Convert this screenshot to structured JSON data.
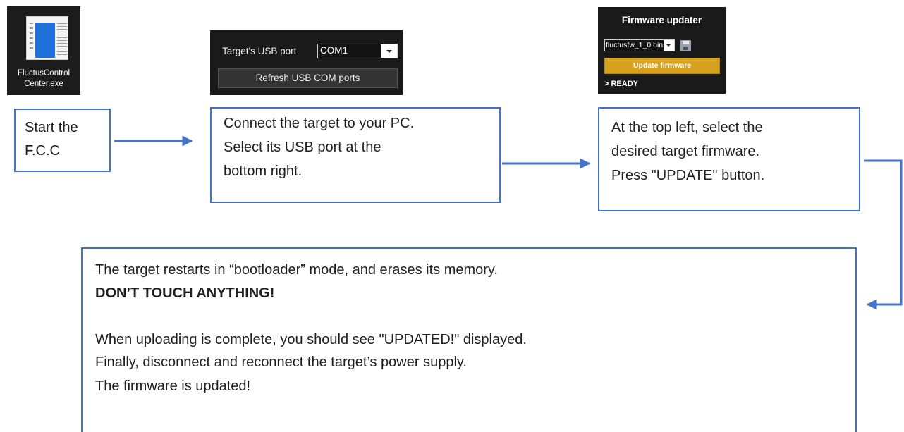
{
  "desktop_icon": {
    "label_line1": "FluctusControl",
    "label_line2": "Center.exe"
  },
  "usb_panel": {
    "port_label": "Target's USB port",
    "port_value": "COM1",
    "refresh_button": "Refresh USB COM ports"
  },
  "firmware_panel": {
    "title": "Firmware updater",
    "file_value": "fluctusfw_1_0.bin",
    "update_button": "Update firmware",
    "status": "> READY"
  },
  "steps": {
    "step1": {
      "line1": "Start the",
      "line2": "F.C.C"
    },
    "step2": {
      "line1": "Connect the target to your PC.",
      "line2": "Select its USB port at the",
      "line3": "bottom right."
    },
    "step3": {
      "line1": "At the top left, select the",
      "line2": "desired target firmware.",
      "line3": "Press \"UPDATE\" button."
    },
    "step4": {
      "line1": "The target restarts in “bootloader” mode, and erases its memory.",
      "warning": "DON’T TOUCH ANYTHING!",
      "line3": "When uploading is complete, you should see \"UPDATED!\" displayed.",
      "line4": "Finally, disconnect and reconnect the target’s power supply.",
      "final": "The firmware is updated!"
    }
  },
  "colors": {
    "box_border": "#4472c4",
    "arrow": "#4472c4",
    "final_text": "#1f6fe0",
    "update_button": "#d6a11f"
  }
}
